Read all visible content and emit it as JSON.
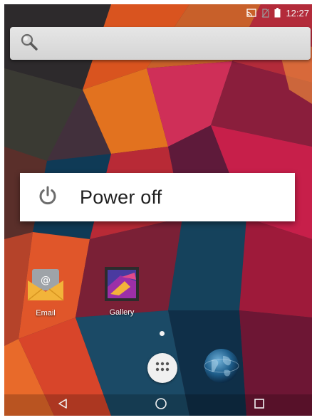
{
  "status_bar": {
    "time": "12:27",
    "icons": [
      "cast-icon",
      "no-sim-icon",
      "battery-icon"
    ]
  },
  "search_bar": {
    "icon": "search-icon"
  },
  "power_menu": {
    "items": [
      {
        "label": "Power off",
        "icon": "power-icon"
      }
    ]
  },
  "home_screen": {
    "apps": [
      {
        "label": "Email",
        "icon": "email-icon"
      },
      {
        "label": "Gallery",
        "icon": "gallery-icon"
      }
    ],
    "dock": [
      {
        "name": "all-apps",
        "icon": "all-apps-icon"
      },
      {
        "name": "browser",
        "icon": "globe-icon"
      }
    ],
    "page_count": 1,
    "current_page": 1
  },
  "navigation_bar": {
    "buttons": [
      "back-icon",
      "home-icon",
      "recents-icon"
    ]
  },
  "colors": {
    "menu_background": "#ffffff",
    "menu_text": "#212121",
    "search_bar": "#dddddd"
  }
}
